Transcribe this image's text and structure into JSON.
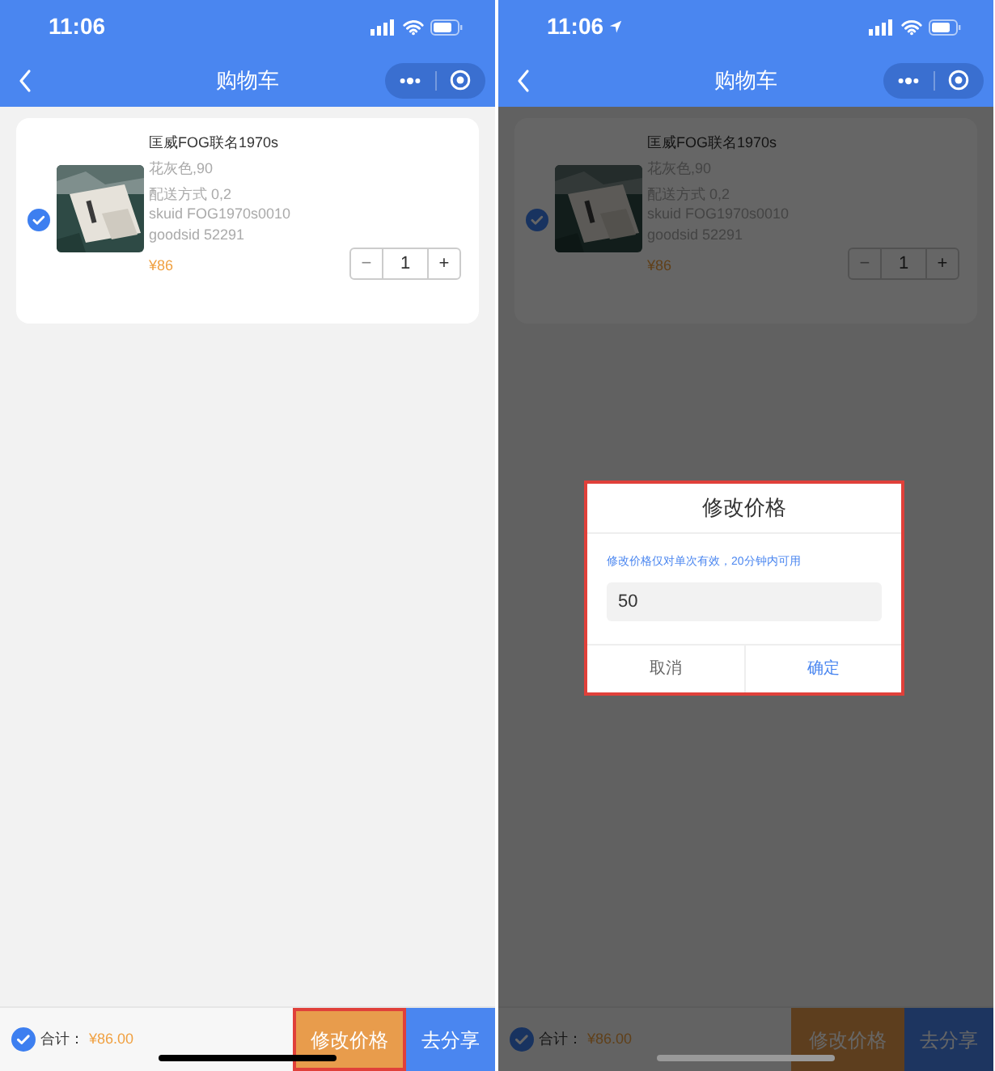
{
  "screens": [
    {
      "status_bar": {
        "time": "11:06",
        "location_arrow": false
      },
      "nav": {
        "title": "购物车"
      },
      "cart_items": [
        {
          "name": "匡威FOG联名1970s",
          "spec": "花灰色,90",
          "delivery": "配送方式 0,2",
          "skuid": "skuid FOG1970s0010",
          "goodsid": "goodsid 52291",
          "price": "¥86",
          "minus": "−",
          "quantity": "1",
          "plus": "+",
          "checked": true
        }
      ],
      "footer": {
        "all_checked": true,
        "total_label": "合计：",
        "total": "¥86.00",
        "buttons": [
          {
            "label": "修改价格",
            "kind": "edit",
            "highlighted": true
          },
          {
            "label": "去分享",
            "kind": "share",
            "highlighted": false
          }
        ]
      }
    },
    {
      "status_bar": {
        "time": "11:06",
        "location_arrow": true
      },
      "nav": {
        "title": "购物车"
      },
      "cart_items": [
        {
          "name": "匡威FOG联名1970s",
          "spec": "花灰色,90",
          "delivery": "配送方式 0,2",
          "skuid": "skuid FOG1970s0010",
          "goodsid": "goodsid 52291",
          "price": "¥86",
          "minus": "−",
          "quantity": "1",
          "plus": "+",
          "checked": true
        }
      ],
      "footer": {
        "all_checked": true,
        "total_label": "合计：",
        "total": "¥86.00",
        "buttons": [
          {
            "label": "修改价格",
            "kind": "edit",
            "highlighted": false
          },
          {
            "label": "去分享",
            "kind": "share",
            "highlighted": false
          }
        ]
      },
      "dialog": {
        "title": "修改价格",
        "hint": "修改价格仅对单次有效，20分钟内可用",
        "value": "50",
        "highlighted": true,
        "buttons": [
          {
            "label": "取消",
            "kind": "cancel"
          },
          {
            "label": "确定",
            "kind": "confirm"
          }
        ]
      }
    }
  ]
}
